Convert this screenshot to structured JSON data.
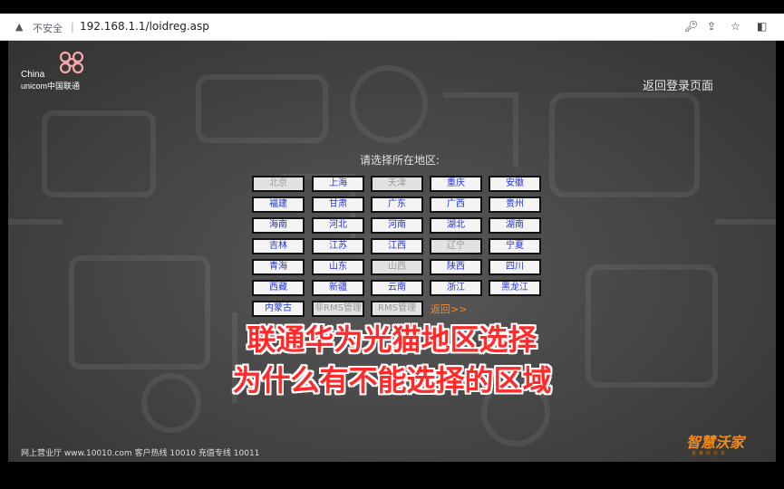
{
  "browser": {
    "security_label": "不安全",
    "url": "192.168.1.1/loidreg.asp"
  },
  "header": {
    "logo_line1": "China",
    "logo_line2": "unicom中国联通",
    "return_login": "返回登录页面"
  },
  "main": {
    "prompt": "请选择所在地区:",
    "regions": [
      {
        "label": "北京",
        "enabled": false
      },
      {
        "label": "上海",
        "enabled": true
      },
      {
        "label": "天津",
        "enabled": false
      },
      {
        "label": "重庆",
        "enabled": true
      },
      {
        "label": "安徽",
        "enabled": true
      },
      {
        "label": "福建",
        "enabled": true
      },
      {
        "label": "甘肃",
        "enabled": true
      },
      {
        "label": "广东",
        "enabled": true
      },
      {
        "label": "广西",
        "enabled": true
      },
      {
        "label": "贵州",
        "enabled": true
      },
      {
        "label": "海南",
        "enabled": true
      },
      {
        "label": "河北",
        "enabled": true
      },
      {
        "label": "河南",
        "enabled": true
      },
      {
        "label": "湖北",
        "enabled": true
      },
      {
        "label": "湖南",
        "enabled": true
      },
      {
        "label": "吉林",
        "enabled": true
      },
      {
        "label": "江苏",
        "enabled": true
      },
      {
        "label": "江西",
        "enabled": true
      },
      {
        "label": "辽宁",
        "enabled": false
      },
      {
        "label": "宁夏",
        "enabled": true
      },
      {
        "label": "青海",
        "enabled": true
      },
      {
        "label": "山东",
        "enabled": true
      },
      {
        "label": "山西",
        "enabled": false
      },
      {
        "label": "陕西",
        "enabled": true
      },
      {
        "label": "四川",
        "enabled": true
      },
      {
        "label": "西藏",
        "enabled": true
      },
      {
        "label": "新疆",
        "enabled": true
      },
      {
        "label": "云南",
        "enabled": true
      },
      {
        "label": "浙江",
        "enabled": true
      },
      {
        "label": "黑龙江",
        "enabled": true
      },
      {
        "label": "内蒙古",
        "enabled": true
      },
      {
        "label": "非RMS管理",
        "enabled": false
      },
      {
        "label": "RMS管理",
        "enabled": false
      }
    ],
    "back_link": "返回>>"
  },
  "footer": {
    "text": "网上营业厅 www.10010.com   客户热线 10010   充值专线 10011"
  },
  "brand": {
    "name": "智慧沃家",
    "sub": "更美好共享"
  },
  "overlay": {
    "line1": "联通华为光猫地区选择",
    "line2": "为什么有不能选择的区域"
  },
  "colors": {
    "region_link": "#2233dd",
    "region_disabled": "#9a9a9a",
    "back_link": "#ff8a1f",
    "caption": "#ff2b2b",
    "brand": "#f08a1c"
  }
}
